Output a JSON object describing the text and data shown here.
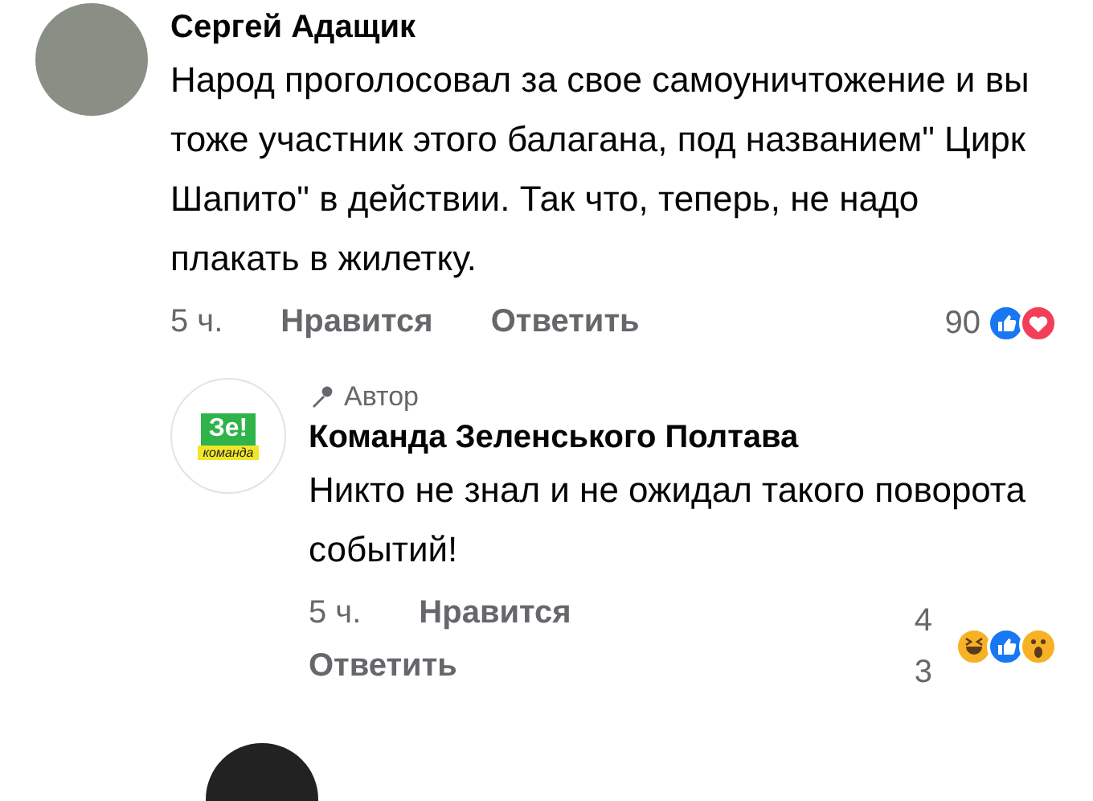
{
  "comments": [
    {
      "author": "Сергей Адащик",
      "avatar": {
        "kind": "photo"
      },
      "text": "Народ проголосовал за свое самоуничтожение и вы тоже участник этого балагана, под названием\" Цирк Шапито\" в действии. Так что, теперь, не надо плакать в жилетку.",
      "time": "5 ч.",
      "like": "Нравится",
      "reply": "Ответить",
      "reaction_count": "90",
      "reactions": [
        {
          "kind": "like"
        },
        {
          "kind": "love"
        }
      ],
      "replies": [
        {
          "author": "Команда Зеленського Полтава",
          "avatar": {
            "kind": "logo",
            "text": "Зе!",
            "subtext": "команда"
          },
          "author_badge": "Автор",
          "text": "Никто не знал и не ожидал такого поворота событий!",
          "time": "5 ч.",
          "like": "Нравится",
          "reply": "Ответить",
          "reaction_count": "43",
          "reactions": [
            {
              "kind": "haha"
            },
            {
              "kind": "like"
            },
            {
              "kind": "wow"
            }
          ]
        }
      ]
    }
  ]
}
